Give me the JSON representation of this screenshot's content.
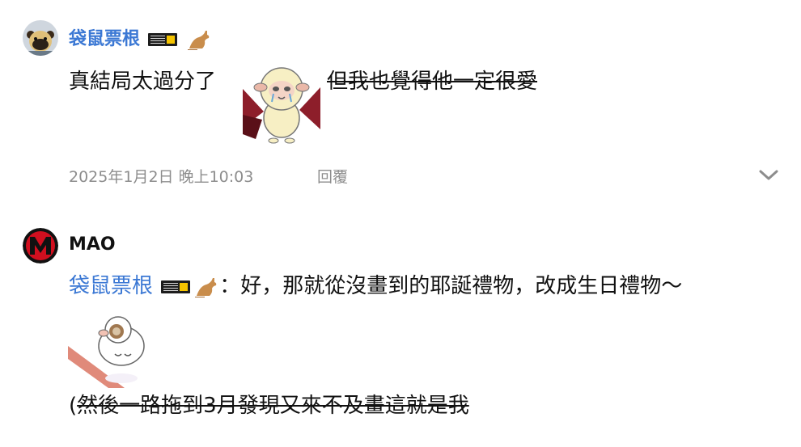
{
  "comment1": {
    "username": "袋鼠票根",
    "text_before": "真結局太過分了",
    "text_after_strike": "但我也覺得他一定很愛",
    "timestamp": "2025年1月2日 晚上10:03",
    "reply_label": "回覆"
  },
  "comment2": {
    "username": "MAO",
    "mention": "袋鼠票根",
    "text": "：好，那就從沒畫到的耶誕禮物，改成生日禮物～",
    "last_line_prefix": "(",
    "last_line_strike": "然後一路拖到3月發現又來不及畫這就是我"
  },
  "icons": {
    "avatar1": "bear-avatar-icon",
    "avatar2": "red-m-logo-icon",
    "ticket": "concert-ticket-icon",
    "kangaroo": "kangaroo-emoji-icon",
    "expand": "chevron-down-icon"
  },
  "colors": {
    "link": "#3b78d4",
    "meta": "#8d8d8d",
    "text": "#111111"
  }
}
